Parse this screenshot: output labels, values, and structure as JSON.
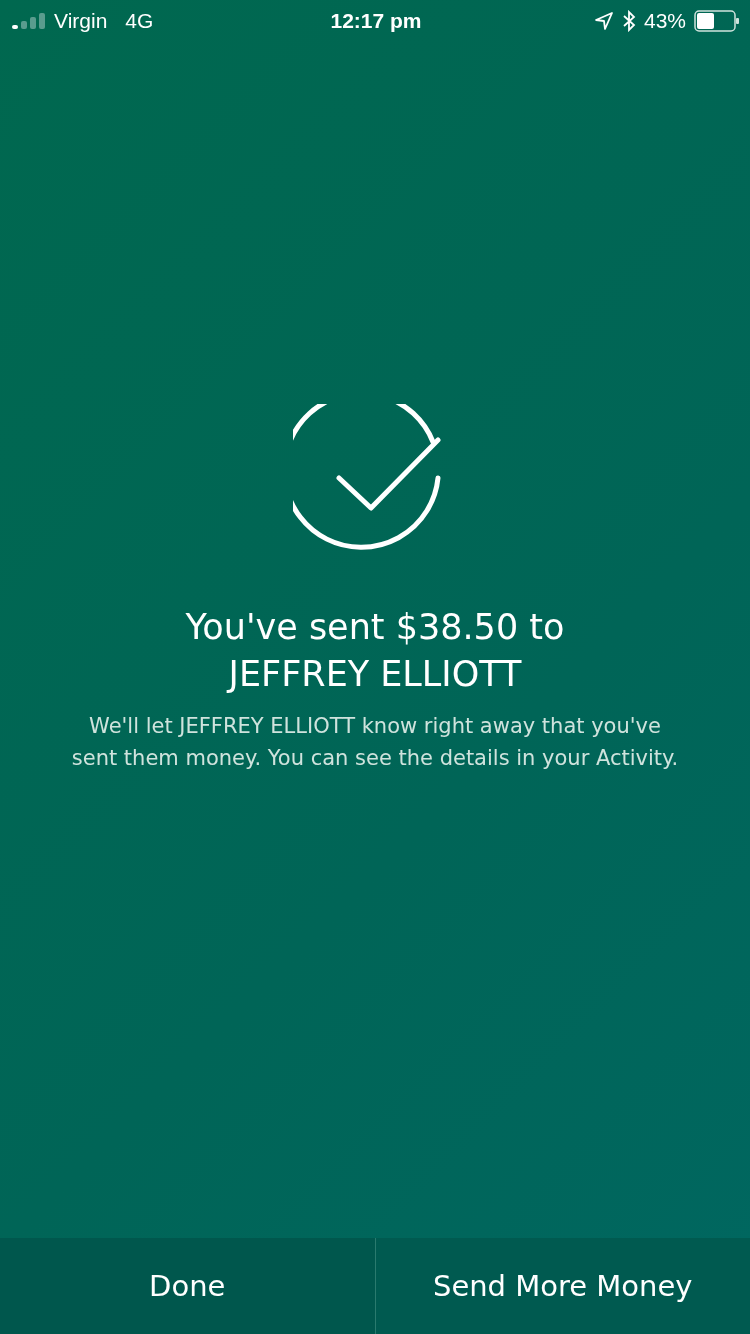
{
  "status_bar": {
    "carrier": "Virgin",
    "network": "4G",
    "time": "12:17 pm",
    "battery": "43%"
  },
  "confirmation": {
    "title": "You've sent $38.50 to JEFFREY ELLIOTT",
    "message": "We'll let JEFFREY ELLIOTT know right away that you've sent them money. You can see the details in your Activity."
  },
  "actions": [
    {
      "label": "Done"
    },
    {
      "label": "Send More Money"
    }
  ]
}
